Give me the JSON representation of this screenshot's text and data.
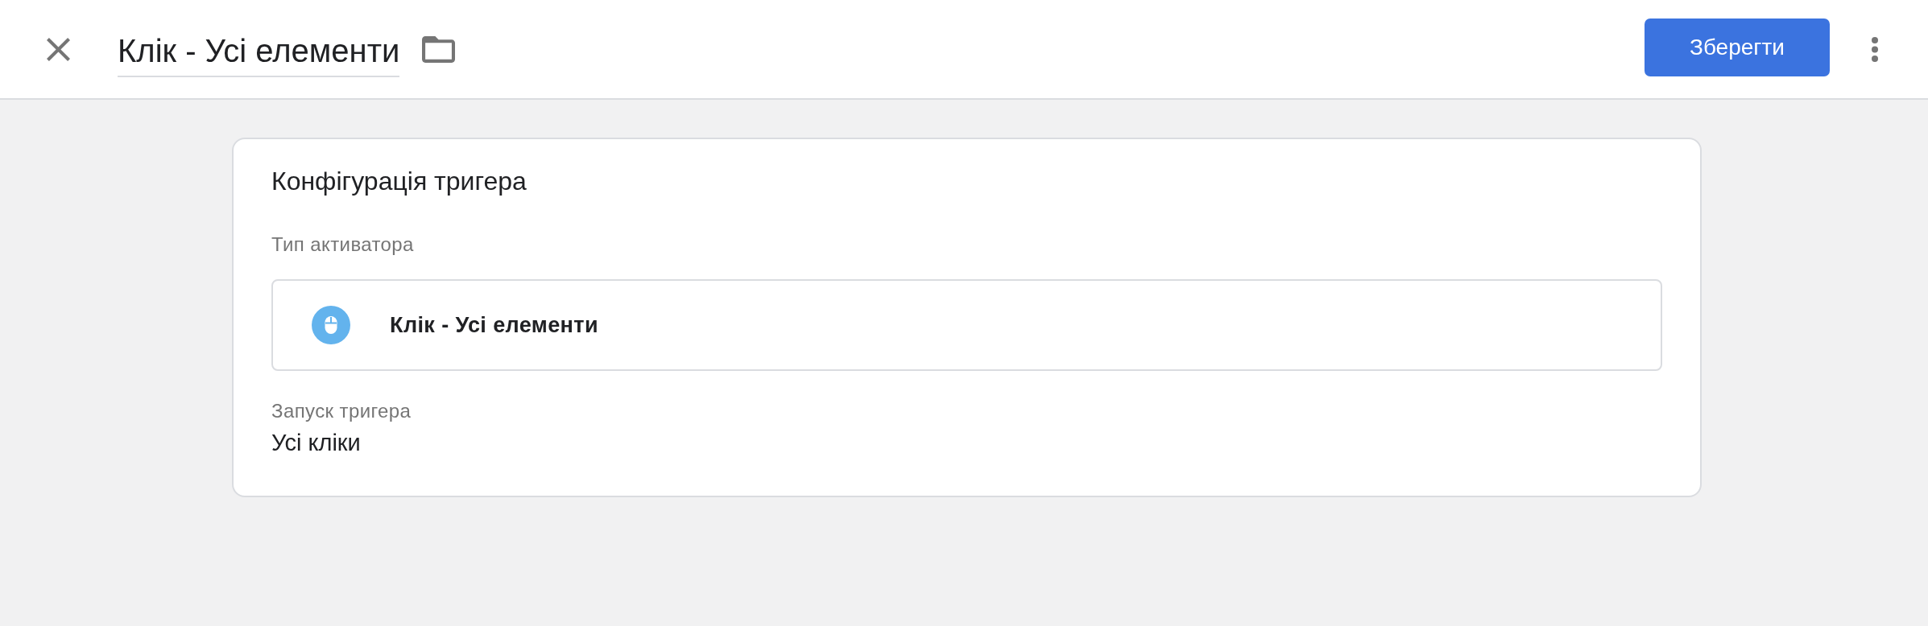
{
  "header": {
    "title": "Клік - Усі елементи",
    "save_button": "Зберегти"
  },
  "trigger_configuration": {
    "title": "Конфігурація тригера",
    "trigger_type": {
      "label": "Тип активатора",
      "name": "Клік - Усі елементи"
    },
    "firing": {
      "label": "Запуск тригера",
      "value": "Усі кліки"
    }
  }
}
